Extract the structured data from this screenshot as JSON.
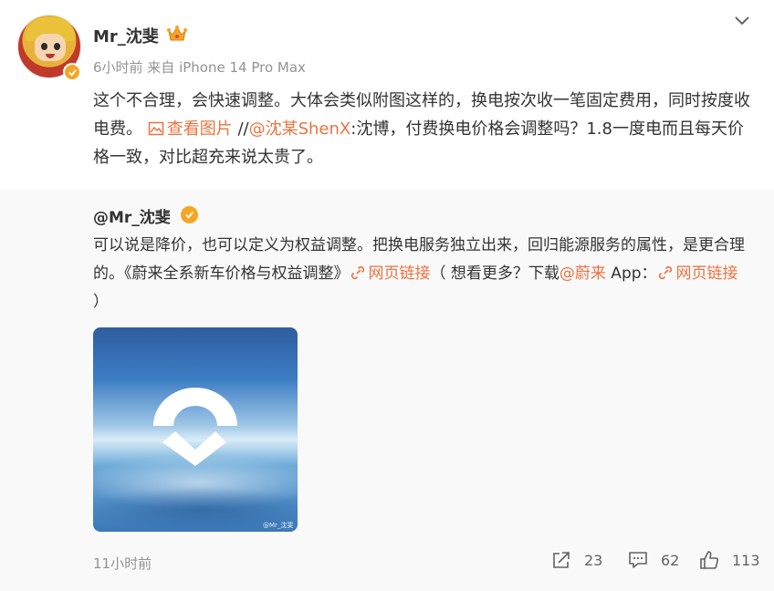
{
  "post": {
    "username": "Mr_沈斐",
    "meta": "6小时前  来自 iPhone 14 Pro Max",
    "text_part1": "这个不合理，会快速调整。大体会类似附图这样的，换电按次收一笔固定费用，同时按度收电费。",
    "view_image_label": "查看图片",
    "slashes": " //",
    "mention": "@沈某ShenX",
    "text_part2": ":沈博，付费换电价格会调整吗？1.8一度电而且每天价格一致，对比超充来说太贵了。"
  },
  "repost": {
    "username": "@Mr_沈斐",
    "text_part1": "可以说是降价，也可以定义为权益调整。把换电服务独立出来，回归能源服务的属性，是更合理的。《蔚来全系新车价格与权益调整》",
    "link1_label": "网页链接",
    "text_part2": "（ 想看更多？下载",
    "mention": "@蔚来",
    "text_part3": " App：",
    "link2_label": "网页链接",
    "text_part4": " ）",
    "image_watermark": "@Mr_沈斐",
    "time_ago": "11小时前"
  },
  "actions": {
    "share_count": "23",
    "comment_count": "62",
    "like_count": "113"
  },
  "icons": {
    "verified": "verified-badge-icon",
    "crown": "crown-icon",
    "chevron": "chevron-down-icon",
    "image": "image-icon",
    "link": "link-icon",
    "share": "share-icon",
    "comment": "comment-icon",
    "like": "thumbs-up-icon"
  },
  "colors": {
    "accent": "#eb7340",
    "verified": "#f5a623",
    "muted": "#939393"
  }
}
